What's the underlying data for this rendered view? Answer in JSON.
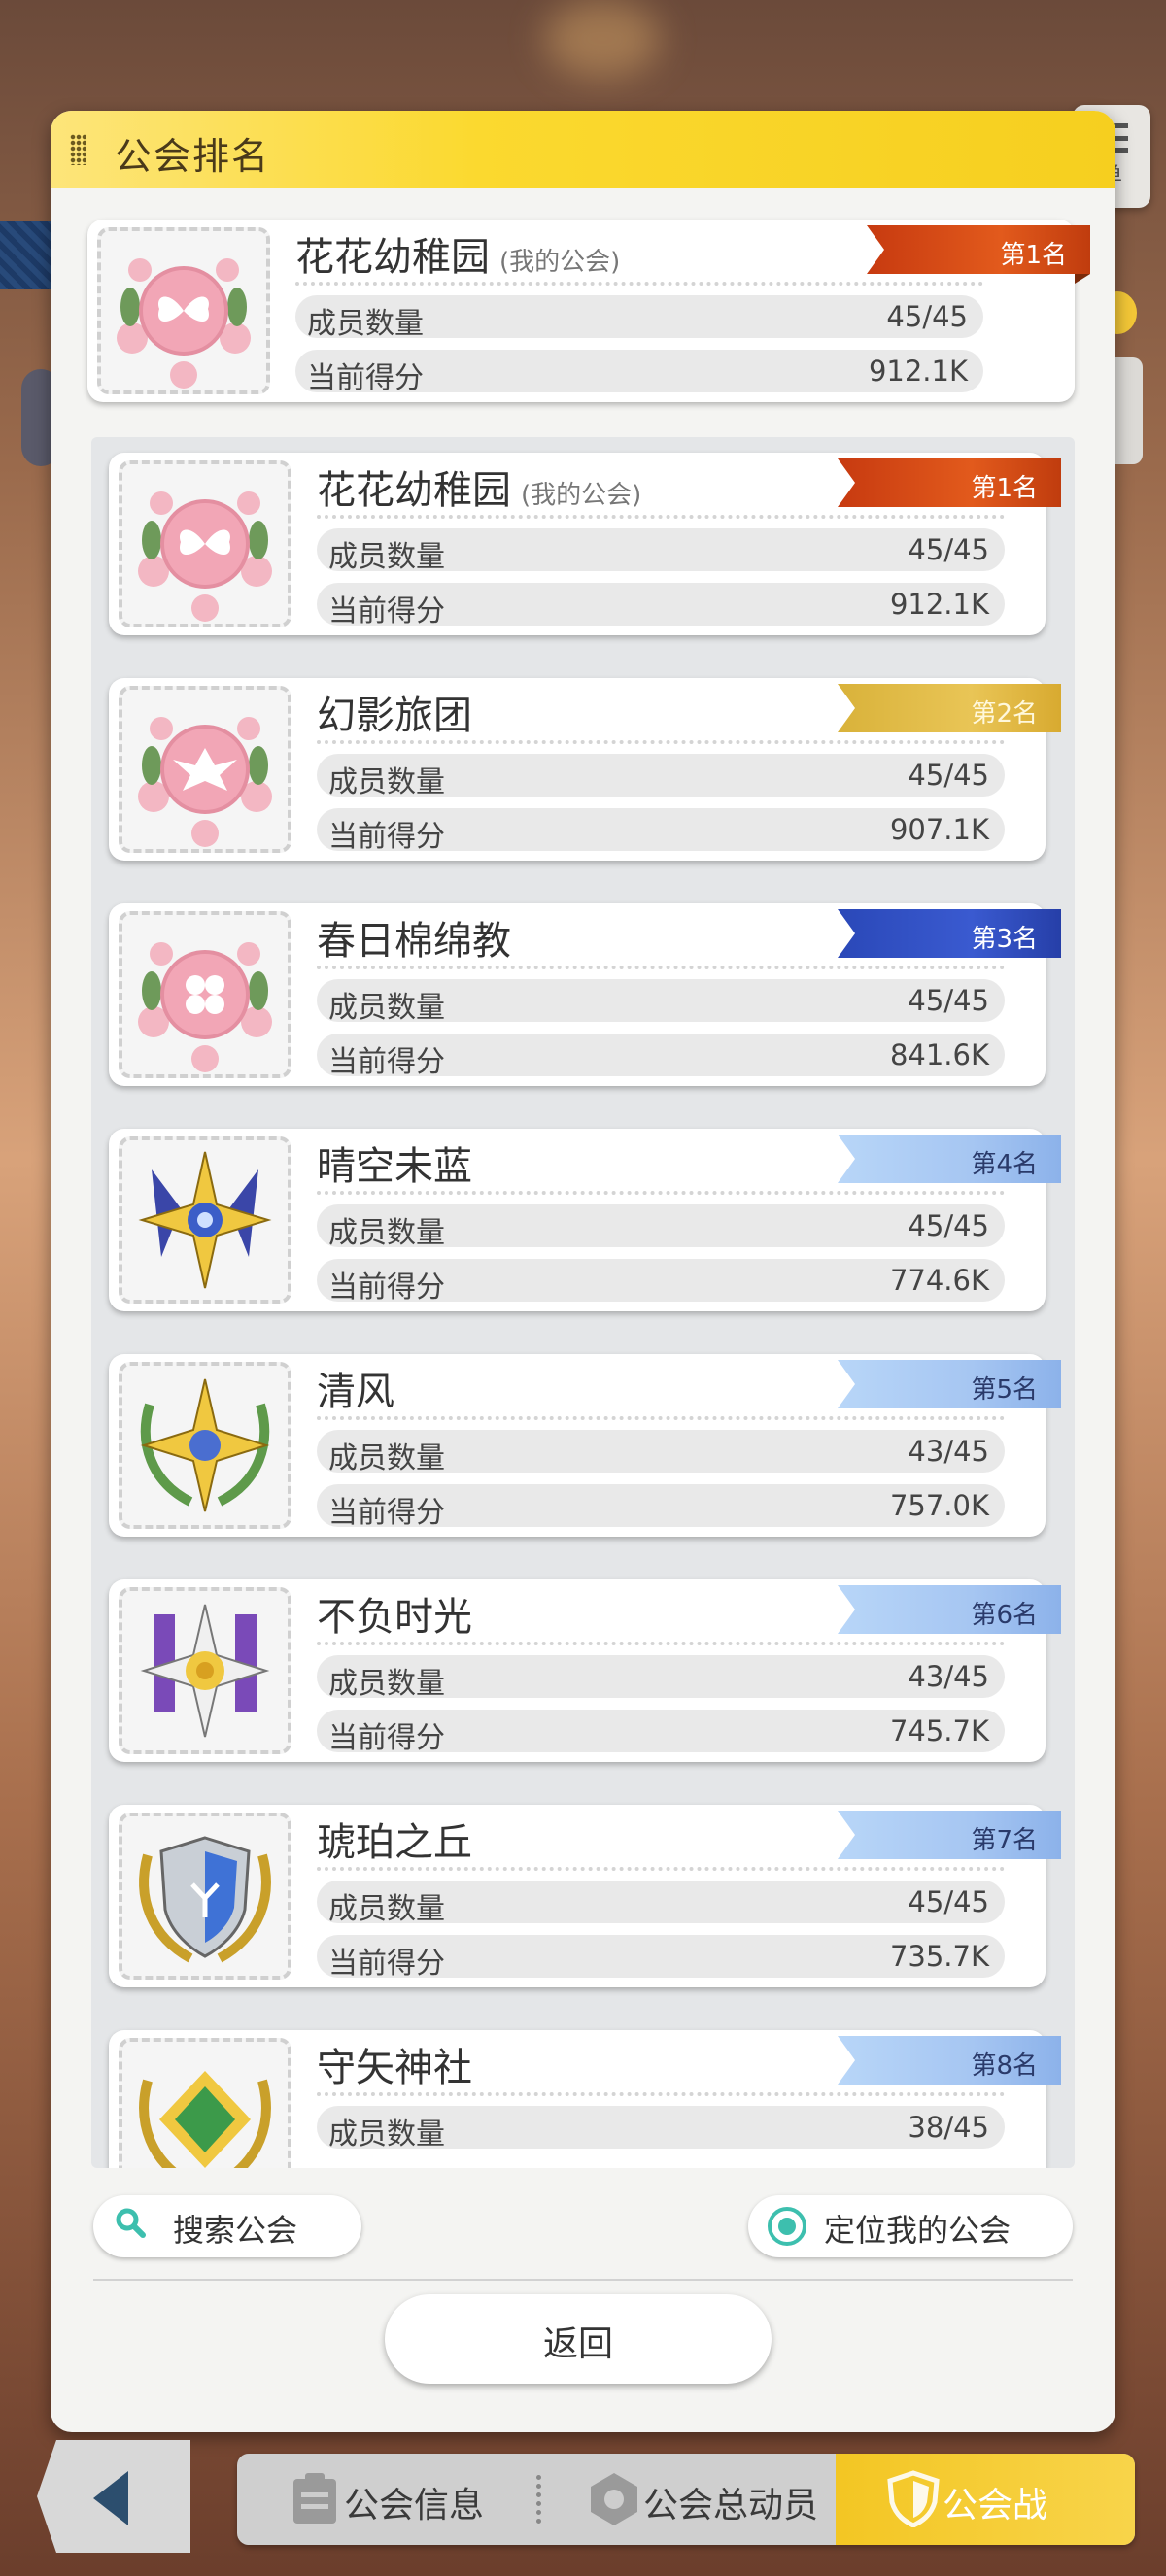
{
  "header": {
    "title": "公会排名"
  },
  "side": {
    "menu_label": "单"
  },
  "pinned": {
    "name": "花花幼稚园",
    "mine_tag": "(我的公会)",
    "rank": "第1名",
    "members_label": "成员数量",
    "members": "45/45",
    "score_label": "当前得分",
    "score": "912.1K",
    "emblem": "rose-wreath-butterfly-emblem-icon"
  },
  "guilds": [
    {
      "name": "花花幼稚园",
      "mine_tag": "(我的公会)",
      "rank": "第1名",
      "members_label": "成员数量",
      "members": "45/45",
      "score_label": "当前得分",
      "score": "912.1K"
    },
    {
      "name": "幻影旅团",
      "mine_tag": "",
      "rank": "第2名",
      "members_label": "成员数量",
      "members": "45/45",
      "score_label": "当前得分",
      "score": "907.1K"
    },
    {
      "name": "春日棉绵教",
      "mine_tag": "",
      "rank": "第3名",
      "members_label": "成员数量",
      "members": "45/45",
      "score_label": "当前得分",
      "score": "841.6K"
    },
    {
      "name": "晴空未蓝",
      "mine_tag": "",
      "rank": "第4名",
      "members_label": "成员数量",
      "members": "45/45",
      "score_label": "当前得分",
      "score": "774.6K"
    },
    {
      "name": "清风",
      "mine_tag": "",
      "rank": "第5名",
      "members_label": "成员数量",
      "members": "43/45",
      "score_label": "当前得分",
      "score": "757.0K"
    },
    {
      "name": "不负时光",
      "mine_tag": "",
      "rank": "第6名",
      "members_label": "成员数量",
      "members": "43/45",
      "score_label": "当前得分",
      "score": "745.7K"
    },
    {
      "name": "琥珀之丘",
      "mine_tag": "",
      "rank": "第7名",
      "members_label": "成员数量",
      "members": "45/45",
      "score_label": "当前得分",
      "score": "735.7K"
    },
    {
      "name": "守矢神社",
      "mine_tag": "",
      "rank": "第8名",
      "members_label": "成员数量",
      "members": "38/45",
      "score_label": "当前得分",
      "score": ""
    }
  ],
  "actions": {
    "search": "搜索公会",
    "locate": "定位我的公会",
    "back": "返回"
  },
  "nav": {
    "tab1": "公会信息",
    "tab2": "公会总动员",
    "tab3": "公会战"
  },
  "colors": {
    "header": "#fbd92f",
    "accent_gold": "#f3c623",
    "locate_teal": "#3dbfae",
    "rank_red": "#d94a16",
    "rank_gold": "#e0b840",
    "rank_blue": "#3450c0",
    "rank_light": "#a6c6f2"
  }
}
